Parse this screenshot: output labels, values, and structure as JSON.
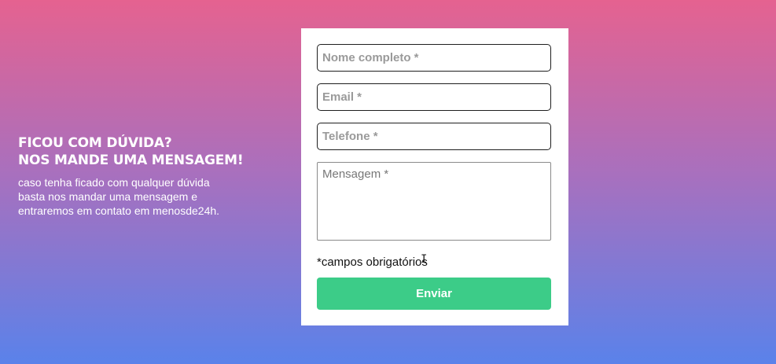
{
  "intro": {
    "heading_line1": "FICOU COM DÚVIDA?",
    "heading_line2": "NOS MANDE UMA MENSAGEM!",
    "description": "caso tenha ficado com qualquer dúvida basta nos mandar uma mensagem e entraremos em contato em menosde24h."
  },
  "form": {
    "name_placeholder": "Nome completo *",
    "email_placeholder": "Email *",
    "phone_placeholder": "Telefone *",
    "message_placeholder": "Mensagem *",
    "required_note": "*campos obrigatórios",
    "submit_label": "Enviar"
  },
  "icons": {
    "text_cursor": "text-cursor-icon"
  },
  "colors": {
    "gradient_top": "#e56290",
    "gradient_bottom": "#5a82ea",
    "submit_button": "#3ccc88"
  }
}
